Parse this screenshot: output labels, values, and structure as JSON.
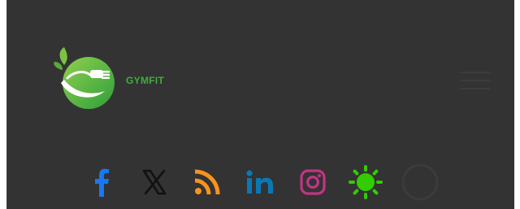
{
  "brand": {
    "name": "GYMFIT",
    "logo_icon": "leaf-fork-logo",
    "colors": {
      "brand_green": "#3fae3f",
      "leaf_green": "#7cc144",
      "background": "#333333"
    }
  },
  "header": {
    "menu_icon": "hamburger-menu-icon"
  },
  "social": [
    {
      "name": "facebook-icon",
      "color": "#1877f2"
    },
    {
      "name": "x-twitter-icon",
      "color": "#111111"
    },
    {
      "name": "rss-icon",
      "color": "#f7931e"
    },
    {
      "name": "linkedin-icon",
      "color": "#0a78b5"
    },
    {
      "name": "instagram-icon",
      "color": "#c13584"
    },
    {
      "name": "sun-icon",
      "color": "#33cc00"
    },
    {
      "name": "moon-toggle-icon",
      "color": "#3a3a3a"
    }
  ]
}
